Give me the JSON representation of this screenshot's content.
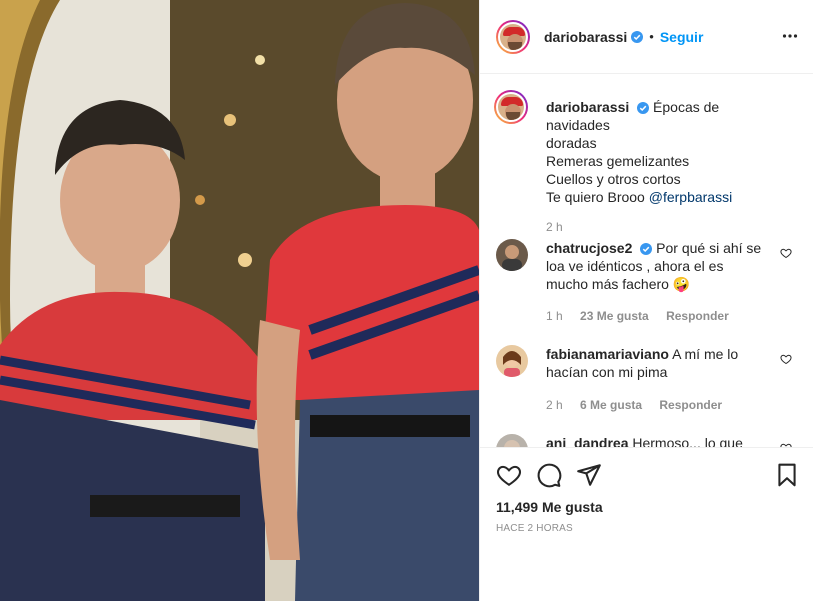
{
  "post": {
    "username": "dariobarassi",
    "follow_label": "Seguir",
    "separator": "•",
    "icons": {
      "more": "more-horizontal-icon",
      "verified": "verified-badge-icon"
    }
  },
  "caption": {
    "username": "dariobarassi",
    "lines": [
      "Épocas de navidades",
      "doradas",
      "Remeras gemelizantes",
      "Cuellos y otros cortos",
      "Te quiero Brooo "
    ],
    "mention": "@ferpbarassi",
    "time": "2 h"
  },
  "comments": [
    {
      "username": "chatrucjose2",
      "text_lines": [
        "Por qué si ahí se",
        "loa ve idénticos , ahora el es",
        "mucho más fachero 🤪"
      ],
      "time": "1 h",
      "likes": "23 Me gusta",
      "reply": "Responder"
    },
    {
      "username": "fabianamariaviano",
      "text_lines": [
        "A mí me lo",
        "hacían con mi pima"
      ],
      "time": "2 h",
      "likes": "6 Me gusta",
      "reply": "Responder"
    },
    {
      "username": "ani_dandrea",
      "text_lines": [
        "Hermoso... lo que"
      ],
      "time": "",
      "likes": "",
      "reply": ""
    }
  ],
  "footer": {
    "likes": "11,499 Me gusta",
    "time_ago": "HACE 2 HORAS",
    "icons": [
      "heart-icon",
      "comment-icon",
      "share-icon",
      "bookmark-icon"
    ]
  },
  "colors": {
    "follow": "#0095f6",
    "verified": "#3897f0",
    "meta": "#8e8e8e",
    "mention": "#00376b"
  }
}
